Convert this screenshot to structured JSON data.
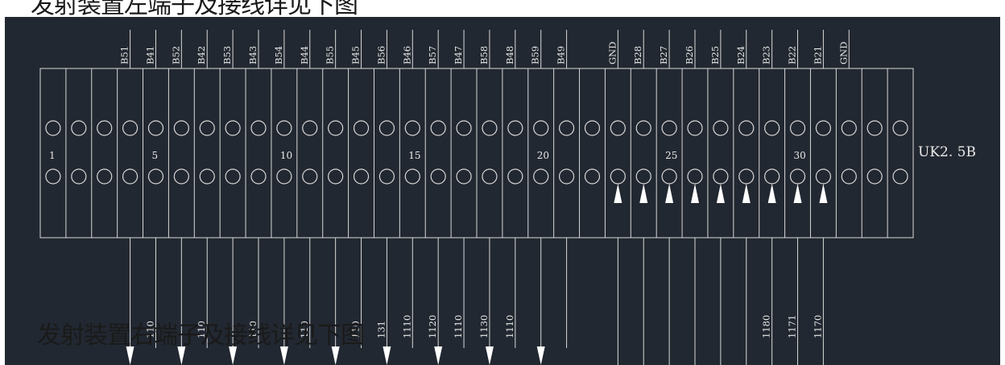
{
  "captions": {
    "top": "发射装置左端子及接线详见下图",
    "bottom": "发射装置右端子及接线详见下图"
  },
  "block_label": "UK2. 5B",
  "terminal_numbers": [
    "1",
    "5",
    "10",
    "15",
    "20",
    "25",
    "30"
  ],
  "wire_labels_top": [
    "B51",
    "B41",
    "B52",
    "B42",
    "B53",
    "B43",
    "B54",
    "B44",
    "B55",
    "B45",
    "B56",
    "B46",
    "B57",
    "B47",
    "B58",
    "B48",
    "B59",
    "B49",
    "GND",
    "B28",
    "B27",
    "B26",
    "B25",
    "B24",
    "B23",
    "B22",
    "B21",
    "GND"
  ],
  "wire_labels_bottom": [
    "110",
    "110",
    "110",
    "110",
    "110",
    "131",
    "1110",
    "1120",
    "1110",
    "1130",
    "1110",
    "1180",
    "1171",
    "1170"
  ],
  "colors": {
    "background": "#222831",
    "lines": "#d8d8d8",
    "text": "#e8e8e8",
    "arrows": "#ffffff",
    "caption": "#1a1a1a"
  }
}
